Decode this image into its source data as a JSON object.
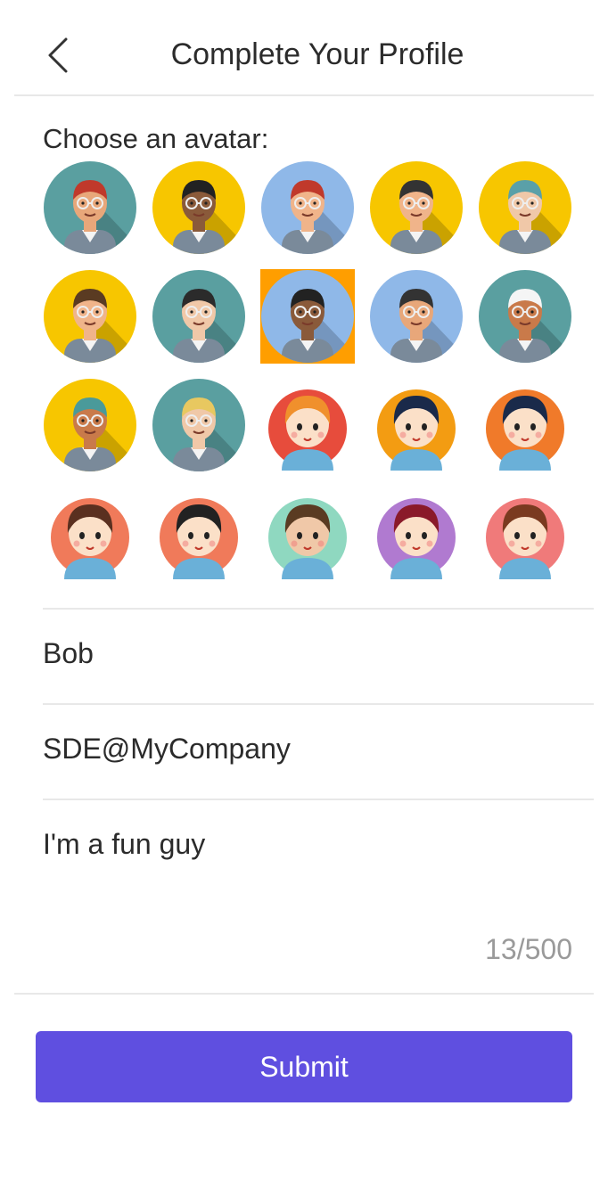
{
  "header": {
    "title": "Complete Your Profile",
    "back_icon": "chevron-left-icon"
  },
  "avatar_section": {
    "label": "Choose an avatar:",
    "selected_index": 7,
    "avatars": [
      {
        "icon": "man-red-cap-beard-avatar",
        "bg": "#5a9fa0",
        "skin": "#e8a77a",
        "hair": "#c0392b",
        "variant": "flat"
      },
      {
        "icon": "man-glasses-dark-skin-avatar",
        "bg": "#f7c600",
        "skin": "#8a5a3a",
        "hair": "#222",
        "variant": "flat"
      },
      {
        "icon": "woman-red-hair-avatar",
        "bg": "#8fb8e8",
        "skin": "#f0b48a",
        "hair": "#c0392b",
        "variant": "flat"
      },
      {
        "icon": "man-mustache-bowtie-avatar",
        "bg": "#f7c600",
        "skin": "#f0b48a",
        "hair": "#333",
        "variant": "flat"
      },
      {
        "icon": "woman-teal-hair-glasses-avatar",
        "bg": "#f7c600",
        "skin": "#f0c8a8",
        "hair": "#5aa0a8",
        "variant": "flat"
      },
      {
        "icon": "man-beard-glasses-avatar",
        "bg": "#f7c600",
        "skin": "#f0b48a",
        "hair": "#5a3b22",
        "variant": "flat"
      },
      {
        "icon": "woman-red-glasses-avatar",
        "bg": "#5a9fa0",
        "skin": "#f0c8a8",
        "hair": "#2b2b2b",
        "variant": "flat"
      },
      {
        "icon": "man-dark-skin-glasses-avatar",
        "bg": "#8fb8e8",
        "skin": "#8a5a3a",
        "hair": "#222",
        "variant": "flat"
      },
      {
        "icon": "man-beard-avatar",
        "bg": "#8fb8e8",
        "skin": "#e8a77a",
        "hair": "#333",
        "variant": "flat"
      },
      {
        "icon": "woman-white-hat-avatar",
        "bg": "#5a9fa0",
        "skin": "#c97a4a",
        "hair": "#f5f5f5",
        "variant": "flat"
      },
      {
        "icon": "man-teal-hat-avatar",
        "bg": "#f7c600",
        "skin": "#c97a4a",
        "hair": "#4a9a9a",
        "variant": "flat"
      },
      {
        "icon": "blonde-woman-glasses-avatar",
        "bg": "#5a9fa0",
        "skin": "#f0c8a8",
        "hair": "#e8c860",
        "variant": "flat"
      },
      {
        "icon": "girl-orange-bun-avatar",
        "bg": "#e74c3c",
        "skin": "#fbe0c8",
        "hair": "#f0902c",
        "variant": "cartoon"
      },
      {
        "icon": "girl-ponytail-mask-avatar",
        "bg": "#f39c12",
        "skin": "#fbe0c8",
        "hair": "#1a2a4a",
        "variant": "cartoon"
      },
      {
        "icon": "boy-blue-glasses-avatar",
        "bg": "#f07a2a",
        "skin": "#fbe0c8",
        "hair": "#1a2a4a",
        "variant": "cartoon"
      },
      {
        "icon": "woman-scarf-glasses-avatar",
        "bg": "#f07a5a",
        "skin": "#fbe0c8",
        "hair": "#5a3020",
        "variant": "cartoon"
      },
      {
        "icon": "boy-laughing-avatar",
        "bg": "#f07a5a",
        "skin": "#fbe0c8",
        "hair": "#222",
        "variant": "cartoon"
      },
      {
        "icon": "man-beard-suit-avatar",
        "bg": "#8fd8c0",
        "skin": "#f0c8a8",
        "hair": "#5a3b22",
        "variant": "cartoon"
      },
      {
        "icon": "woman-crown-avatar",
        "bg": "#b07ad0",
        "skin": "#fbe0c8",
        "hair": "#8a1a2a",
        "variant": "cartoon"
      },
      {
        "icon": "man-glasses-orange-avatar",
        "bg": "#f07a7a",
        "skin": "#fbe0c8",
        "hair": "#7a3a20",
        "variant": "cartoon"
      }
    ]
  },
  "form": {
    "name_value": "Bob",
    "title_value": "SDE@MyCompany",
    "bio_value": "I'm a fun guy",
    "bio_counter": "13/500"
  },
  "submit": {
    "label": "Submit",
    "color": "#5f4fe0"
  }
}
